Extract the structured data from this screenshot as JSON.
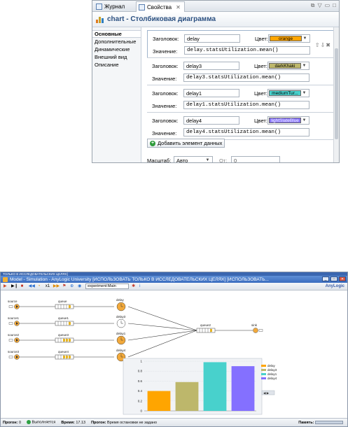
{
  "props_panel": {
    "tabs": [
      {
        "label": "Журнал"
      },
      {
        "label": "Свойства",
        "active": true
      }
    ],
    "title": "chart - Столбиковая диаграмма",
    "nav": [
      "Основные",
      "Дополнительные",
      "Динамические",
      "Внешний вид",
      "Описание"
    ],
    "label_title": "Заголовок:",
    "label_color": "Цвет:",
    "label_value": "Значение:",
    "items": [
      {
        "title": "delay",
        "color_name": "orange",
        "color": "#ffa500",
        "value": "delay.statsUtilization.mean()"
      },
      {
        "title": "delay3",
        "color_name": "darkKhaki",
        "color": "#bdb76b",
        "value": "delay3.statsUtilization.mean()"
      },
      {
        "title": "delay1",
        "color_name": "mediumTur...",
        "color": "#48d1cc",
        "value": "delay1.statsUtilization.mean()"
      },
      {
        "title": "delay4",
        "color_name": "lightSlateBlue",
        "color": "#8470ff",
        "value": "delay4.statsUtilization.mean()"
      }
    ],
    "add_button": "Добавить элемент данных",
    "scale_label": "Масштаб:",
    "scale_value": "Авто",
    "scale_from_label": "От:",
    "scale_from_value": "0"
  },
  "sim_window": {
    "caption": "ТОЛЬКО В ИССЛЕДОВАТЕЛЬСКИХ ЦЕЛЯХ]",
    "title": "Model - Simulation - AnyLogic University  [ИСПОЛЬЗОВАТЬ ТОЛЬКО В ИССЛЕДОВАТЕЛЬСКИХ ЦЕЛЯХ]  [ИСПОЛЬЗОВАТЬ...",
    "toolbar": {
      "speed": "x1",
      "experiment": "experiment:Main",
      "brand": "AnyLogic"
    },
    "model": {
      "sources": [
        "source",
        "source1",
        "source2",
        "source3"
      ],
      "queues": [
        "queue",
        "queue1",
        "queue3",
        "queue4"
      ],
      "delays": [
        "delay",
        "delay3",
        "delay1",
        "delay4"
      ],
      "queue2": "queue2",
      "sink": "sink"
    },
    "status": {
      "run_label": "Прогон:",
      "run_value": "0",
      "state": "Выполняется",
      "time_label": "Время:",
      "time_value": "17.13",
      "progress_label": "Прогон:",
      "progress_value": "Время остановки не задано",
      "memory_label": "Память:"
    }
  },
  "chart_data": {
    "type": "bar",
    "categories": [
      "delay",
      "delay3",
      "delay1",
      "delay4"
    ],
    "values": [
      0.4,
      0.58,
      0.98,
      0.9
    ],
    "colors": [
      "#ffa500",
      "#bdb76b",
      "#48d1cc",
      "#8470ff"
    ],
    "ylim": [
      0,
      1
    ],
    "yticks": [
      "0",
      "0.2",
      "0.4",
      "0.6",
      "0.8",
      "1"
    ],
    "legend": [
      "delay",
      "delay3",
      "delay1",
      "delay4"
    ],
    "legend_placement": "right",
    "grid": true
  }
}
